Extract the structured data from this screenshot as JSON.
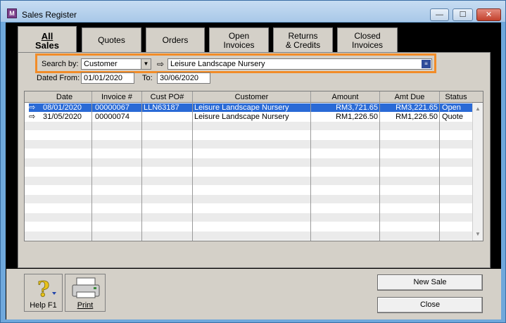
{
  "window": {
    "title": "Sales Register",
    "app_icon": "M",
    "min": "—",
    "max": "☐",
    "close": "✕"
  },
  "tabs": [
    {
      "line1": "All",
      "line2": "Sales"
    },
    {
      "line1": "Quotes",
      "line2": ""
    },
    {
      "line1": "Orders",
      "line2": ""
    },
    {
      "line1": "Open",
      "line2": "Invoices"
    },
    {
      "line1": "Returns",
      "line2": "& Credits"
    },
    {
      "line1": "Closed",
      "line2": "Invoices"
    }
  ],
  "search": {
    "search_by_label": "Search by:",
    "search_by_value": "Customer",
    "customer_value": "Leisure Landscape Nursery",
    "dated_from_label": "Dated From:",
    "dated_from_value": "01/01/2020",
    "to_label": "To:",
    "to_value": "30/06/2020"
  },
  "table": {
    "columns": [
      "Date",
      "Invoice #",
      "Cust PO#",
      "Customer",
      "Amount",
      "Amt Due",
      "Status"
    ],
    "rows": [
      {
        "date": "08/01/2020",
        "invoice": "00000067",
        "cust_po": "LLN63187",
        "customer": "Leisure Landscape Nursery",
        "amount": "RM3,721.65",
        "amt_due": "RM3,221.65",
        "status": "Open"
      },
      {
        "date": "31/05/2020",
        "invoice": "00000074",
        "cust_po": "",
        "customer": "Leisure Landscape Nursery",
        "amount": "RM1,226.50",
        "amt_due": "RM1,226.50",
        "status": "Quote"
      }
    ]
  },
  "buttons": {
    "help": "Help F1",
    "print": "Print",
    "new_sale": "New Sale",
    "close": "Close"
  },
  "colors": {
    "highlight_border": "#f28c28",
    "selection": "#2a6ad6"
  }
}
